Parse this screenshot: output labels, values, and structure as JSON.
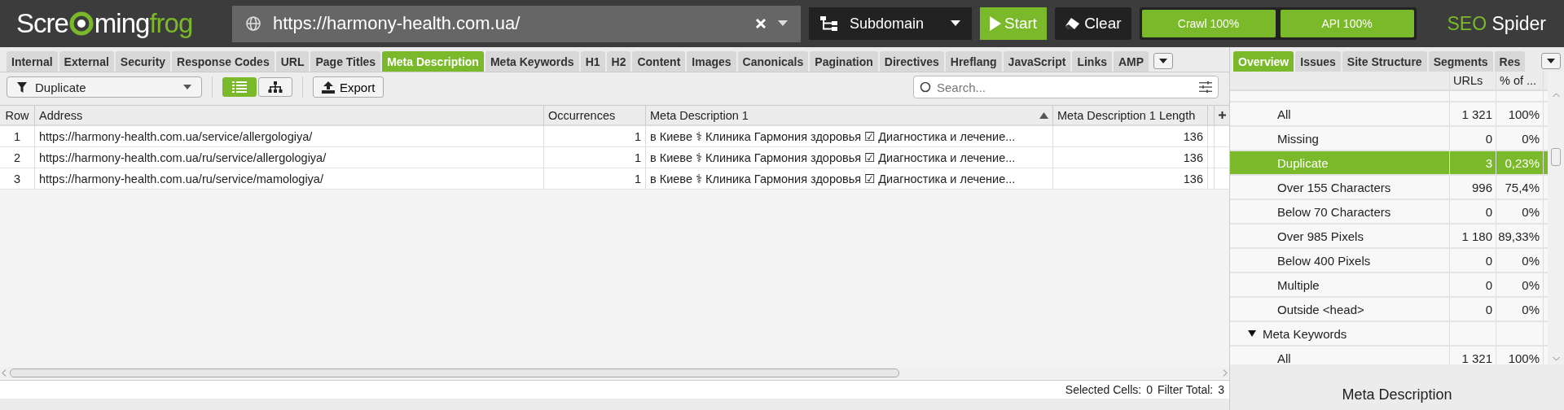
{
  "header": {
    "logo": [
      "Scre",
      "ming",
      "frog"
    ],
    "url": "https://harmony-health.com.ua/",
    "mode": "Subdomain",
    "start": "Start",
    "clear": "Clear",
    "progress": [
      {
        "label": "Crawl 100%",
        "level": 1
      },
      {
        "label": "API 100%",
        "level": 1
      }
    ],
    "brand": [
      "SEO",
      "Spider"
    ]
  },
  "tabs": [
    {
      "label": "Internal",
      "selected": false
    },
    {
      "label": "External",
      "selected": false
    },
    {
      "label": "Security",
      "selected": false
    },
    {
      "label": "Response Codes",
      "selected": false
    },
    {
      "label": "URL",
      "selected": false
    },
    {
      "label": "Page Titles",
      "selected": false
    },
    {
      "label": "Meta Description",
      "selected": true
    },
    {
      "label": "Meta Keywords",
      "selected": false
    },
    {
      "label": "H1",
      "selected": false
    },
    {
      "label": "H2",
      "selected": false
    },
    {
      "label": "Content",
      "selected": false
    },
    {
      "label": "Images",
      "selected": false
    },
    {
      "label": "Canonicals",
      "selected": false
    },
    {
      "label": "Pagination",
      "selected": false
    },
    {
      "label": "Directives",
      "selected": false
    },
    {
      "label": "Hreflang",
      "selected": false
    },
    {
      "label": "JavaScript",
      "selected": false
    },
    {
      "label": "Links",
      "selected": false
    },
    {
      "label": "AMP",
      "selected": false
    }
  ],
  "toolbar": {
    "filter": "Duplicate",
    "views": [
      {
        "kind": "list",
        "selected": true
      },
      {
        "kind": "tree",
        "selected": false
      }
    ],
    "export": "Export",
    "search": {
      "placeholder": "Search..."
    }
  },
  "table": {
    "columns": [
      {
        "label": "Row",
        "sorted": false
      },
      {
        "label": "Address",
        "sorted": false
      },
      {
        "label": "Occurrences",
        "sorted": false
      },
      {
        "label": "Meta Description 1",
        "sorted": true
      },
      {
        "label": "Meta Description 1 Length",
        "sorted": false
      }
    ],
    "rows": [
      [
        "1",
        "https://harmony-health.com.ua/service/allergologiya/",
        "1",
        "в Киеве ⚕ Клиника Гармония здоровья ☑ Диагностика и лечение...",
        "136"
      ],
      [
        "2",
        "https://harmony-health.com.ua/ru/service/allergologiya/",
        "1",
        "в Киеве ⚕ Клиника Гармония здоровья ☑ Диагностика и лечение...",
        "136"
      ],
      [
        "3",
        "https://harmony-health.com.ua/ru/service/mamologiya/",
        "1",
        "в Киеве ⚕ Клиника Гармония здоровья ☑ Диагностика и лечение...",
        "136"
      ]
    ]
  },
  "status_bar": {
    "selected_cells_label": "Selected Cells:",
    "selected_cells": "0",
    "filter_total_label": "Filter Total:",
    "filter_total": "3"
  },
  "side_tabs": [
    {
      "label": "Overview",
      "selected": true
    },
    {
      "label": "Issues",
      "selected": false
    },
    {
      "label": "Site Structure",
      "selected": false
    },
    {
      "label": "Segments",
      "selected": false
    },
    {
      "label": "Res",
      "selected": false
    }
  ],
  "overview": {
    "columns": [
      "URLs",
      "% of ..."
    ],
    "items": [
      {
        "label": "All",
        "urls": "1 321",
        "percent": "100%",
        "selected": false
      },
      {
        "label": "Missing",
        "urls": "0",
        "percent": "0%",
        "selected": false
      },
      {
        "label": "Duplicate",
        "urls": "3",
        "percent": "0,23%",
        "selected": true
      },
      {
        "label": "Over 155 Characters",
        "urls": "996",
        "percent": "75,4%",
        "selected": false
      },
      {
        "label": "Below 70 Characters",
        "urls": "0",
        "percent": "0%",
        "selected": false
      },
      {
        "label": "Over 985 Pixels",
        "urls": "1 180",
        "percent": "89,33%",
        "selected": false
      },
      {
        "label": "Below 400 Pixels",
        "urls": "0",
        "percent": "0%",
        "selected": false
      },
      {
        "label": "Multiple",
        "urls": "0",
        "percent": "0%",
        "selected": false
      },
      {
        "label": "Outside <head>",
        "urls": "0",
        "percent": "0%",
        "selected": false
      }
    ],
    "groups": [
      {
        "label": "Meta Keywords",
        "expanded": true,
        "children": [
          {
            "label": "All",
            "urls": "1 321",
            "percent": "100%",
            "selected": false
          }
        ]
      }
    ]
  },
  "footer_title": "Meta Description"
}
